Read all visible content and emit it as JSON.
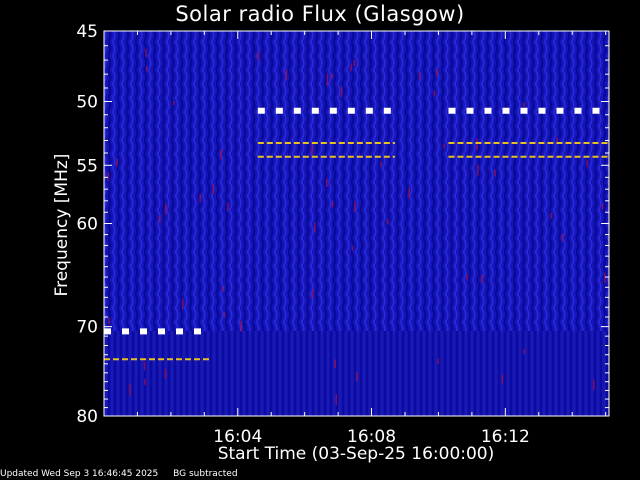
{
  "chart_data": {
    "type": "heatmap",
    "title": "Solar radio Flux (Glasgow)",
    "xlabel": "Start Time (03-Sep-25 16:00:00)",
    "ylabel": "Frequency [MHz]",
    "x_ticks": [
      "16:04",
      "16:08",
      "16:12"
    ],
    "x_tick_minutes": [
      4,
      8,
      12
    ],
    "xlim_minutes": [
      0,
      15.1
    ],
    "y_ticks": [
      45,
      50,
      55,
      60,
      70,
      80
    ],
    "ylim": [
      45,
      80
    ],
    "y_scale": "log",
    "grid": false,
    "colormap": [
      "#000033",
      "#0000cc",
      "#3344ff",
      "#cc0033"
    ],
    "marked_channels": [
      {
        "x_start_minutes": 0.0,
        "x_end_minutes": 3.2,
        "frequency_mhz": 70.5,
        "style": "white-thick"
      },
      {
        "x_start_minutes": 0.0,
        "x_end_minutes": 3.2,
        "frequency_mhz": 73.5,
        "style": "yellow-thin"
      },
      {
        "x_start_minutes": 4.6,
        "x_end_minutes": 8.7,
        "frequency_mhz": 50.7,
        "style": "white-thick"
      },
      {
        "x_start_minutes": 4.6,
        "x_end_minutes": 8.7,
        "frequency_mhz": 53.2,
        "style": "yellow-thin"
      },
      {
        "x_start_minutes": 4.6,
        "x_end_minutes": 8.7,
        "frequency_mhz": 54.3,
        "style": "yellow-thin"
      },
      {
        "x_start_minutes": 10.3,
        "x_end_minutes": 15.1,
        "frequency_mhz": 50.7,
        "style": "white-thick"
      },
      {
        "x_start_minutes": 10.3,
        "x_end_minutes": 15.1,
        "frequency_mhz": 53.2,
        "style": "yellow-thin"
      },
      {
        "x_start_minutes": 10.3,
        "x_end_minutes": 15.1,
        "frequency_mhz": 54.3,
        "style": "yellow-thin"
      }
    ]
  },
  "footer": {
    "updated": "Updated Wed Sep  3 16:46:45 2025",
    "note": "BG subtracted"
  }
}
